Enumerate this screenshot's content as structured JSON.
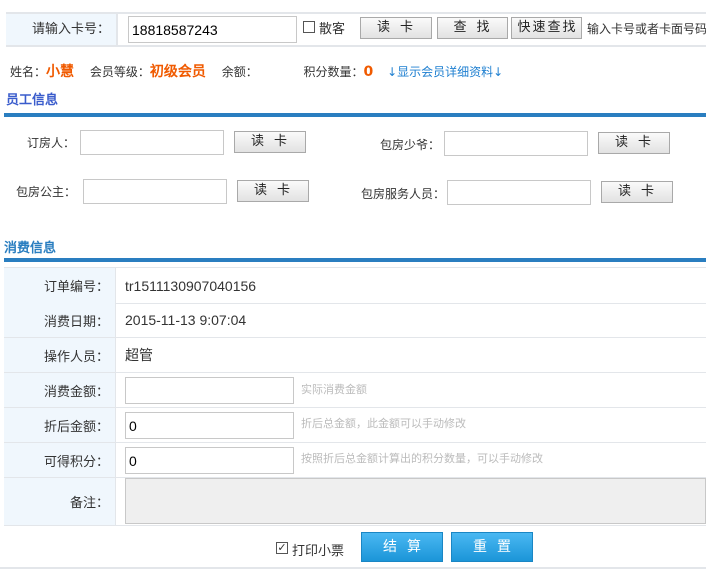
{
  "card": {
    "label": "请输入卡号：",
    "value": "18818587243",
    "walkin_label": "散客",
    "read_btn": "读卡",
    "search_btn": "查找",
    "quick_btn": "快速查找",
    "hint": "输入卡号或者卡面号码"
  },
  "member": {
    "name_label": "姓名：",
    "name": "小慧",
    "level_label": "会员等级：",
    "level": "初级会员",
    "balance_label": "余额：",
    "balance": "",
    "points_label": "积分数量：",
    "points": "0",
    "detail_link": "↓显示会员详细资料↓"
  },
  "staff": {
    "title": "员工信息",
    "fields": [
      {
        "label": "订房人：",
        "value": "",
        "btn": "读卡"
      },
      {
        "label": "包房少爷：",
        "value": "",
        "btn": "读卡"
      },
      {
        "label": "包房公主：",
        "value": "",
        "btn": "读卡"
      },
      {
        "label": "包房服务人员：",
        "value": "",
        "btn": "读卡"
      }
    ]
  },
  "consume": {
    "title": "消费信息",
    "order_label": "订单编号：",
    "order": "tr1511130907040156",
    "date_label": "消费日期：",
    "date": "2015-11-13 9:07:04",
    "operator_label": "操作人员：",
    "operator": "超管",
    "amount_label": "消费金额：",
    "amount": "",
    "amount_hint": "实际消费金额",
    "discount_label": "折后金额：",
    "discount": "0",
    "discount_hint": "折后总金额，此金额可以手动修改",
    "points_label": "可得积分：",
    "points": "0",
    "points_hint": "按照折后总金额计算出的积分数量，可以手动修改",
    "remark_label": "备注：",
    "remark": ""
  },
  "footer": {
    "print_label": "打印小票",
    "print_checked": true,
    "submit": "结算",
    "reset": "重置"
  }
}
